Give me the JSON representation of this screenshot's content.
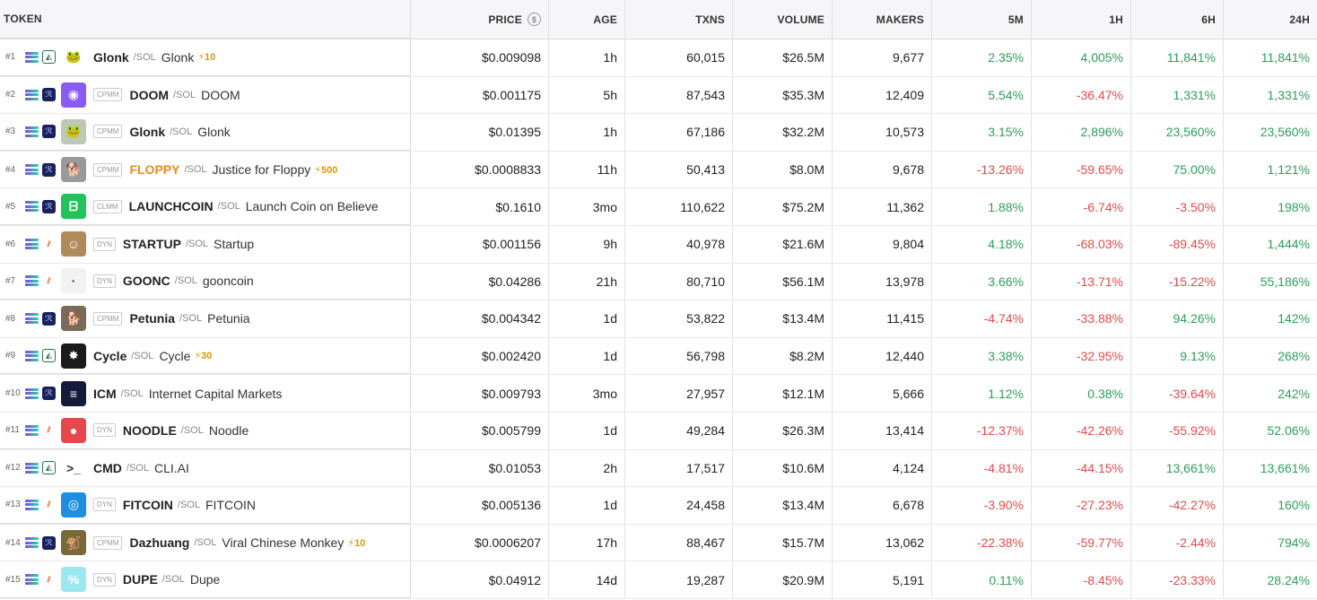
{
  "headers": {
    "token": "TOKEN",
    "price": "PRICE",
    "age": "AGE",
    "txns": "TXNS",
    "volume": "VOLUME",
    "makers": "MAKERS",
    "m5": "5M",
    "h1": "1H",
    "h6": "6H",
    "h24": "24H"
  },
  "rows": [
    {
      "rank": "#1",
      "dex": "pump",
      "pool": "",
      "symbol": "Glonk",
      "quote": "/SOL",
      "name": "Glonk",
      "boost": "⚡10",
      "price": "$0.009098",
      "age": "1h",
      "txns": "60,015",
      "volume": "$26.5M",
      "makers": "9,677",
      "m5": "2.35%",
      "h1": "4,005%",
      "h6": "11,841%",
      "h24": "11,841%",
      "logo_color": "#ffffff",
      "logo_glyph": "🐸"
    },
    {
      "rank": "#2",
      "dex": "ray",
      "pool": "CPMM",
      "symbol": "DOOM",
      "quote": "/SOL",
      "name": "DOOM",
      "boost": "",
      "price": "$0.001175",
      "age": "5h",
      "txns": "87,543",
      "volume": "$35.3M",
      "makers": "12,409",
      "m5": "5.54%",
      "h1": "-36.47%",
      "h6": "1,331%",
      "h24": "1,331%",
      "logo_color": "#8a5bf0",
      "logo_glyph": "◉"
    },
    {
      "rank": "#3",
      "dex": "ray",
      "pool": "CPMM",
      "symbol": "Glonk",
      "quote": "/SOL",
      "name": "Glonk",
      "boost": "",
      "price": "$0.01395",
      "age": "1h",
      "txns": "67,186",
      "volume": "$32.2M",
      "makers": "10,573",
      "m5": "3.15%",
      "h1": "2,896%",
      "h6": "23,560%",
      "h24": "23,560%",
      "logo_color": "#bfc8b4",
      "logo_glyph": "🐸"
    },
    {
      "rank": "#4",
      "dex": "ray",
      "pool": "CPMM",
      "symbol": "FLOPPY",
      "quote": "/SOL",
      "name": "Justice for Floppy",
      "boost": "⚡500",
      "price": "$0.0008833",
      "age": "11h",
      "txns": "50,413",
      "volume": "$8.0M",
      "makers": "9,678",
      "m5": "-13.26%",
      "h1": "-59.65%",
      "h6": "75.00%",
      "h24": "1,121%",
      "logo_color": "#9a9a9a",
      "logo_glyph": "🐕",
      "orange": true
    },
    {
      "rank": "#5",
      "dex": "ray",
      "pool": "CLMM",
      "symbol": "LAUNCHCOIN",
      "quote": "/SOL",
      "name": "Launch Coin on Believe",
      "boost": "",
      "price": "$0.1610",
      "age": "3mo",
      "txns": "110,622",
      "volume": "$75.2M",
      "makers": "11,362",
      "m5": "1.88%",
      "h1": "-6.74%",
      "h6": "-3.50%",
      "h24": "198%",
      "logo_color": "#21c45a",
      "logo_glyph": "ᗷ"
    },
    {
      "rank": "#6",
      "dex": "met",
      "pool": "DYN",
      "symbol": "STARTUP",
      "quote": "/SOL",
      "name": "Startup",
      "boost": "",
      "price": "$0.001156",
      "age": "9h",
      "txns": "40,978",
      "volume": "$21.6M",
      "makers": "9,804",
      "m5": "4.18%",
      "h1": "-68.03%",
      "h6": "-89.45%",
      "h24": "1,444%",
      "logo_color": "#b08a5a",
      "logo_glyph": "☺"
    },
    {
      "rank": "#7",
      "dex": "met",
      "pool": "DYN",
      "symbol": "GOONC",
      "quote": "/SOL",
      "name": "gooncoin",
      "boost": "",
      "price": "$0.04286",
      "age": "21h",
      "txns": "80,710",
      "volume": "$56.1M",
      "makers": "13,978",
      "m5": "3.66%",
      "h1": "-13.71%",
      "h6": "-15.22%",
      "h24": "55,186%",
      "logo_color": "#f2f2f2",
      "logo_glyph": "·"
    },
    {
      "rank": "#8",
      "dex": "ray",
      "pool": "CPMM",
      "symbol": "Petunia",
      "quote": "/SOL",
      "name": "Petunia",
      "boost": "",
      "price": "$0.004342",
      "age": "1d",
      "txns": "53,822",
      "volume": "$13.4M",
      "makers": "11,415",
      "m5": "-4.74%",
      "h1": "-33.88%",
      "h6": "94.26%",
      "h24": "142%",
      "logo_color": "#7a6a58",
      "logo_glyph": "🐕"
    },
    {
      "rank": "#9",
      "dex": "pump",
      "pool": "",
      "symbol": "Cycle",
      "quote": "/SOL",
      "name": "Cycle",
      "boost": "⚡30",
      "price": "$0.002420",
      "age": "1d",
      "txns": "56,798",
      "volume": "$8.2M",
      "makers": "12,440",
      "m5": "3.38%",
      "h1": "-32.95%",
      "h6": "9.13%",
      "h24": "268%",
      "logo_color": "#1a1a1a",
      "logo_glyph": "✸"
    },
    {
      "rank": "#10",
      "dex": "ray",
      "pool": "",
      "symbol": "ICM",
      "quote": "/SOL",
      "name": "Internet Capital Markets",
      "boost": "",
      "price": "$0.009793",
      "age": "3mo",
      "txns": "27,957",
      "volume": "$12.1M",
      "makers": "5,666",
      "m5": "1.12%",
      "h1": "0.38%",
      "h6": "-39.64%",
      "h24": "242%",
      "logo_color": "#131a3a",
      "logo_glyph": "≡"
    },
    {
      "rank": "#11",
      "dex": "met",
      "pool": "DYN",
      "symbol": "NOODLE",
      "quote": "/SOL",
      "name": "Noodle",
      "boost": "",
      "price": "$0.005799",
      "age": "1d",
      "txns": "49,284",
      "volume": "$26.3M",
      "makers": "13,414",
      "m5": "-12.37%",
      "h1": "-42.26%",
      "h6": "-55.92%",
      "h24": "52.06%",
      "logo_color": "#e5484d",
      "logo_glyph": "●"
    },
    {
      "rank": "#12",
      "dex": "pump",
      "pool": "",
      "symbol": "CMD",
      "quote": "/SOL",
      "name": "CLI.AI",
      "boost": "",
      "price": "$0.01053",
      "age": "2h",
      "txns": "17,517",
      "volume": "$10.6M",
      "makers": "4,124",
      "m5": "-4.81%",
      "h1": "-44.15%",
      "h6": "13,661%",
      "h24": "13,661%",
      "logo_color": "#ffffff",
      "logo_glyph": ">_"
    },
    {
      "rank": "#13",
      "dex": "met",
      "pool": "DYN",
      "symbol": "FITCOIN",
      "quote": "/SOL",
      "name": "FITCOIN",
      "boost": "",
      "price": "$0.005136",
      "age": "1d",
      "txns": "24,458",
      "volume": "$13.4M",
      "makers": "6,678",
      "m5": "-3.90%",
      "h1": "-27.23%",
      "h6": "-42.27%",
      "h24": "160%",
      "logo_color": "#1d8ee0",
      "logo_glyph": "◎"
    },
    {
      "rank": "#14",
      "dex": "ray",
      "pool": "CPMM",
      "symbol": "Dazhuang",
      "quote": "/SOL",
      "name": "Viral Chinese Monkey",
      "boost": "⚡10",
      "price": "$0.0006207",
      "age": "17h",
      "txns": "88,467",
      "volume": "$15.7M",
      "makers": "13,062",
      "m5": "-22.38%",
      "h1": "-59.77%",
      "h6": "-2.44%",
      "h24": "794%",
      "logo_color": "#7a6a3a",
      "logo_glyph": "🐒"
    },
    {
      "rank": "#15",
      "dex": "met",
      "pool": "DYN",
      "symbol": "DUPE",
      "quote": "/SOL",
      "name": "Dupe",
      "boost": "",
      "price": "$0.04912",
      "age": "14d",
      "txns": "19,287",
      "volume": "$20.9M",
      "makers": "5,191",
      "m5": "0.11%",
      "h1": "-8.45%",
      "h6": "-23.33%",
      "h24": "28.24%",
      "logo_color": "#9be8f0",
      "logo_glyph": "%"
    }
  ]
}
